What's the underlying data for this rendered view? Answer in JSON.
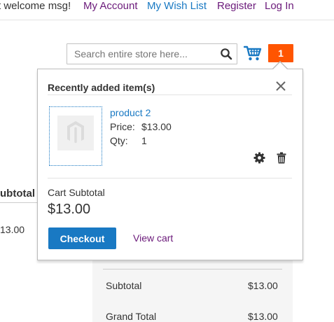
{
  "header": {
    "welcome_text": "t welcome msg!",
    "links": {
      "my_account": "My Account",
      "my_wish_list": "My Wish List",
      "register": "Register",
      "log_in": "Log In"
    }
  },
  "search": {
    "placeholder": "Search entire store here...",
    "value": "",
    "icon": "search-icon"
  },
  "cart": {
    "icon": "cart-icon",
    "count": "1"
  },
  "minicart": {
    "title": "Recently added item(s)",
    "close_icon": "close-icon",
    "item": {
      "name": "product 2",
      "price_label": "Price:",
      "price_value": "$13.00",
      "qty_label": "Qty:",
      "qty_value": "1",
      "edit_icon": "gear-icon",
      "remove_icon": "trash-icon"
    },
    "subtotal_label": "Cart Subtotal",
    "subtotal_value": "$13.00",
    "checkout_label": "Checkout",
    "view_cart_label": "View cart"
  },
  "background_page": {
    "column_header": "ubtotal",
    "row_price": "13.00",
    "summary": {
      "subtotal_label": "Subtotal",
      "subtotal_value": "$13.00",
      "grand_total_label": "Grand Total",
      "grand_total_value": "$13.00"
    }
  },
  "colors": {
    "link_blue": "#1979c3",
    "link_purple": "#6b1a7a",
    "badge_orange": "#ff5501",
    "checkout_blue": "#1979c3"
  }
}
